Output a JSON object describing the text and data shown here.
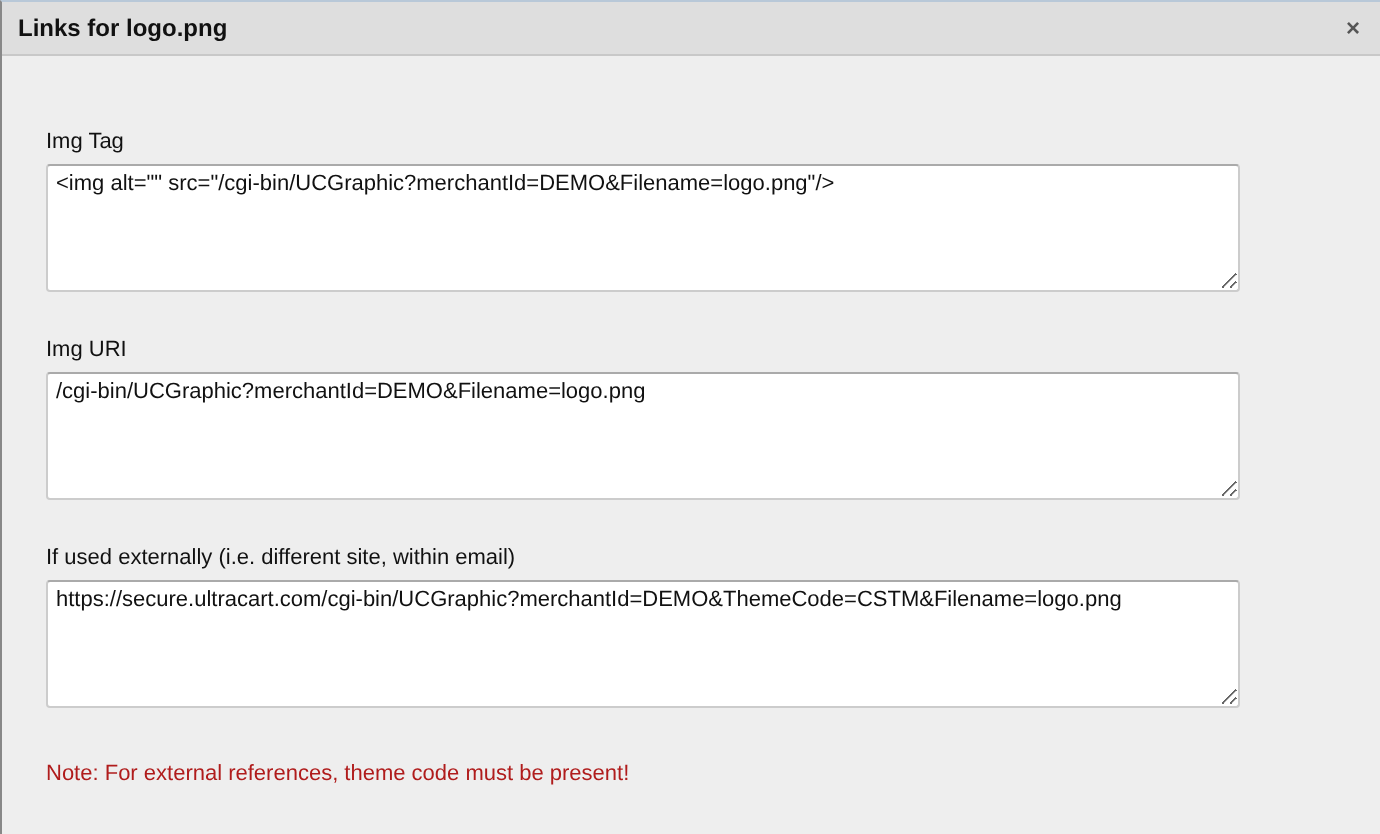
{
  "window": {
    "title": "Links for logo.png",
    "close": "×"
  },
  "fields": [
    {
      "label": "Img Tag",
      "value": "<img alt=\"\" src=\"/cgi-bin/UCGraphic?merchantId=DEMO&Filename=logo.png\"/>"
    },
    {
      "label": "Img URI",
      "value": "/cgi-bin/UCGraphic?merchantId=DEMO&Filename=logo.png"
    },
    {
      "label": "If used externally (i.e. different site, within email)",
      "value": "https://secure.ultracart.com/cgi-bin/UCGraphic?merchantId=DEMO&ThemeCode=CSTM&Filename=logo.png"
    }
  ],
  "note": "Note: For external references, theme code must be present!"
}
